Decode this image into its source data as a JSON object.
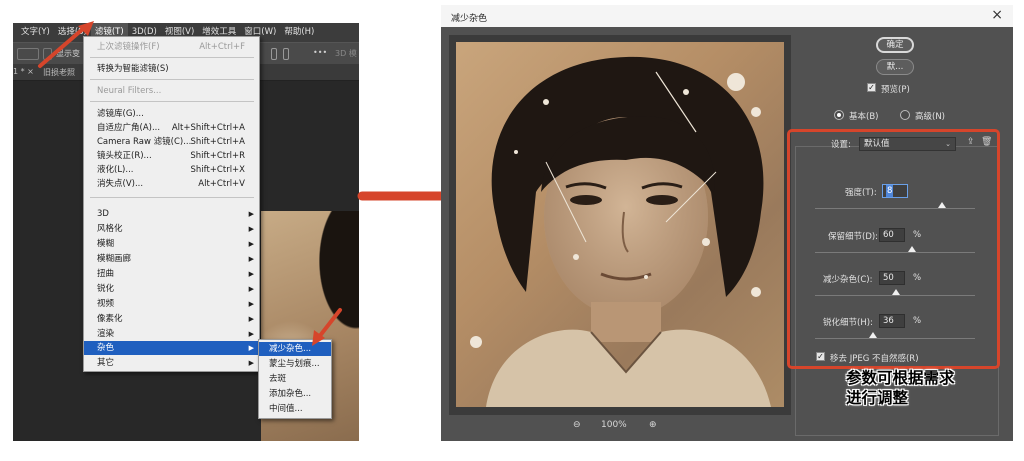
{
  "ps": {
    "menubar": [
      "文字(Y)",
      "选择(S)",
      "滤镜(T)",
      "3D(D)",
      "视图(V)",
      "增效工具",
      "窗口(W)",
      "帮助(H)"
    ],
    "optbar_text": "显示变",
    "optbar_right": "3D 模",
    "tabs": [
      "1 * ×",
      "旧损老照"
    ],
    "filter_menu": {
      "last_filter": "上次滤镜操作(F)",
      "last_filter_shortcut": "Alt+Ctrl+F",
      "smart_filter": "转换为智能滤镜(S)",
      "neural": "Neural Filters...",
      "gallery": "滤镜库(G)...",
      "adaptive_wide": "自适应广角(A)...",
      "adaptive_wide_shortcut": "Alt+Shift+Ctrl+A",
      "camera_raw": "Camera Raw 滤镜(C)...",
      "camera_raw_shortcut": "Shift+Ctrl+A",
      "lens": "镜头校正(R)...",
      "lens_shortcut": "Shift+Ctrl+R",
      "liquify": "液化(L)...",
      "liquify_shortcut": "Shift+Ctrl+X",
      "vanishing": "消失点(V)...",
      "vanishing_shortcut": "Alt+Ctrl+V",
      "groups": [
        "3D",
        "风格化",
        "模糊",
        "模糊画廊",
        "扭曲",
        "锐化",
        "视频",
        "像素化",
        "渲染",
        "杂色",
        "其它"
      ]
    },
    "noise_submenu": [
      "减少杂色...",
      "蒙尘与划痕...",
      "去斑",
      "添加杂色...",
      "中间值..."
    ]
  },
  "dialog": {
    "title": "减少杂色",
    "ok": "确定",
    "cancel": "默...",
    "preview": "预览(P)",
    "basic": "基本(B)",
    "advanced": "高级(N)",
    "setting_label": "设置:",
    "setting_value": "默认值",
    "strength_label": "强度(T):",
    "strength": 8,
    "preserve_label": "保留细节(D):",
    "preserve": 60,
    "reduce_color_label": "减少杂色(C):",
    "reduce_color": 50,
    "sharpen_label": "锐化细节(H):",
    "sharpen": 36,
    "percent": "%",
    "jpeg_label": "移去 JPEG 不自然感(R)",
    "zoom": "100%"
  },
  "annotation": {
    "note_line1": "参数可根据需求",
    "note_line2": "进行调整"
  },
  "colors": {
    "accent_red": "#d6452b",
    "menu_highlight": "#1f5fbf",
    "dialog_body": "#515151"
  }
}
